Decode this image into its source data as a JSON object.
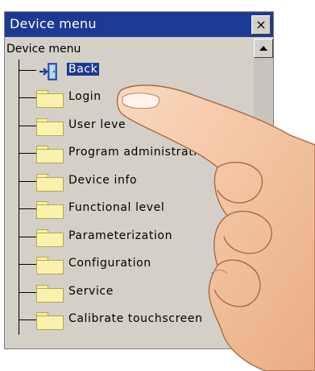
{
  "window": {
    "title": "Device menu",
    "close_symbol": "×"
  },
  "tree": {
    "root_label": "Device menu",
    "items": [
      {
        "label": "Back",
        "icon": "exit-door-icon",
        "selected": true
      },
      {
        "label": "Login",
        "icon": "folder-icon"
      },
      {
        "label": "User leve",
        "icon": "folder-icon"
      },
      {
        "label": "Program administrati",
        "icon": "folder-icon"
      },
      {
        "label": "Device info",
        "icon": "folder-icon"
      },
      {
        "label": "Functional level",
        "icon": "folder-icon"
      },
      {
        "label": "Parameterization",
        "icon": "folder-icon"
      },
      {
        "label": "Configuration",
        "icon": "folder-icon"
      },
      {
        "label": "Service",
        "icon": "folder-icon"
      },
      {
        "label": "Calibrate touchscreen",
        "icon": "folder-icon"
      }
    ]
  },
  "scrollbar": {
    "up_arrow": "scroll-up-arrow-icon"
  },
  "colors": {
    "titlebar": "#1c3a93",
    "window_bg": "#d4d0c8",
    "folder": "#f8f2ad",
    "selection": "#1c3a93"
  }
}
